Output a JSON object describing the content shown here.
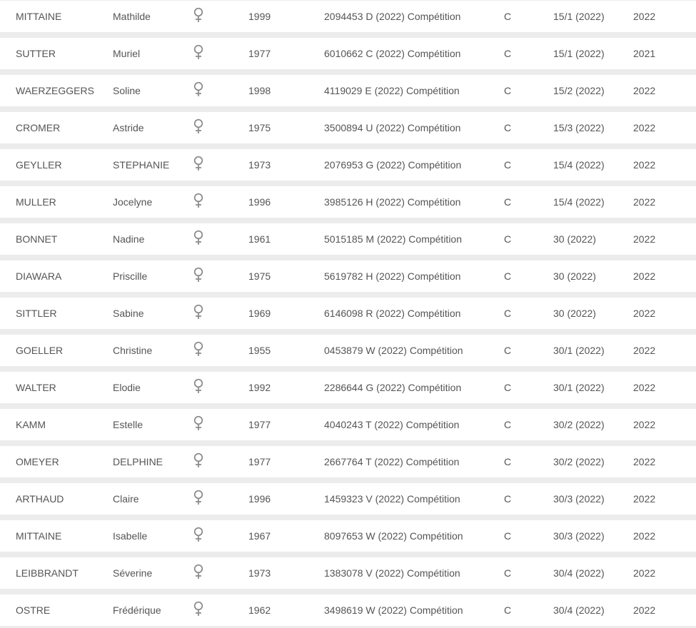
{
  "table": {
    "rows": [
      {
        "nom": "MITTAINE",
        "prenom": "Mathilde",
        "sexe_icon": "female-symbol-icon",
        "naissance": "1999",
        "licence": "2094453 D (2022) Compétition",
        "categorie": "C",
        "classement": "15/1 (2022)",
        "annee": "2022"
      },
      {
        "nom": "SUTTER",
        "prenom": "Muriel",
        "sexe_icon": "female-symbol-icon",
        "naissance": "1977",
        "licence": "6010662 C (2022) Compétition",
        "categorie": "C",
        "classement": "15/1 (2022)",
        "annee": "2021"
      },
      {
        "nom": "WAERZEGGERS",
        "prenom": "Soline",
        "sexe_icon": "female-symbol-icon",
        "naissance": "1998",
        "licence": "4119029 E (2022) Compétition",
        "categorie": "C",
        "classement": "15/2 (2022)",
        "annee": "2022"
      },
      {
        "nom": "CROMER",
        "prenom": "Astride",
        "sexe_icon": "female-symbol-icon",
        "naissance": "1975",
        "licence": "3500894 U (2022) Compétition",
        "categorie": "C",
        "classement": "15/3 (2022)",
        "annee": "2022"
      },
      {
        "nom": "GEYLLER",
        "prenom": "STEPHANIE",
        "sexe_icon": "female-symbol-icon",
        "naissance": "1973",
        "licence": "2076953 G (2022) Compétition",
        "categorie": "C",
        "classement": "15/4 (2022)",
        "annee": "2022"
      },
      {
        "nom": "MULLER",
        "prenom": "Jocelyne",
        "sexe_icon": "female-symbol-icon",
        "naissance": "1996",
        "licence": "3985126 H (2022) Compétition",
        "categorie": "C",
        "classement": "15/4 (2022)",
        "annee": "2022"
      },
      {
        "nom": "BONNET",
        "prenom": "Nadine",
        "sexe_icon": "female-symbol-icon",
        "naissance": "1961",
        "licence": "5015185 M (2022) Compétition",
        "categorie": "C",
        "classement": "30 (2022)",
        "annee": "2022"
      },
      {
        "nom": "DIAWARA",
        "prenom": "Priscille",
        "sexe_icon": "female-symbol-icon",
        "naissance": "1975",
        "licence": "5619782 H (2022) Compétition",
        "categorie": "C",
        "classement": "30 (2022)",
        "annee": "2022"
      },
      {
        "nom": "SITTLER",
        "prenom": "Sabine",
        "sexe_icon": "female-symbol-icon",
        "naissance": "1969",
        "licence": "6146098 R (2022) Compétition",
        "categorie": "C",
        "classement": "30 (2022)",
        "annee": "2022"
      },
      {
        "nom": "GOELLER",
        "prenom": "Christine",
        "sexe_icon": "female-symbol-icon",
        "naissance": "1955",
        "licence": "0453879 W (2022) Compétition",
        "categorie": "C",
        "classement": "30/1 (2022)",
        "annee": "2022"
      },
      {
        "nom": "WALTER",
        "prenom": "Elodie",
        "sexe_icon": "female-symbol-icon",
        "naissance": "1992",
        "licence": "2286644 G (2022) Compétition",
        "categorie": "C",
        "classement": "30/1 (2022)",
        "annee": "2022"
      },
      {
        "nom": "KAMM",
        "prenom": "Estelle",
        "sexe_icon": "female-symbol-icon",
        "naissance": "1977",
        "licence": "4040243 T (2022) Compétition",
        "categorie": "C",
        "classement": "30/2 (2022)",
        "annee": "2022"
      },
      {
        "nom": "OMEYER",
        "prenom": "DELPHINE",
        "sexe_icon": "female-symbol-icon",
        "naissance": "1977",
        "licence": "2667764 T (2022) Compétition",
        "categorie": "C",
        "classement": "30/2 (2022)",
        "annee": "2022"
      },
      {
        "nom": "ARTHAUD",
        "prenom": "Claire",
        "sexe_icon": "female-symbol-icon",
        "naissance": "1996",
        "licence": "1459323 V (2022) Compétition",
        "categorie": "C",
        "classement": "30/3 (2022)",
        "annee": "2022"
      },
      {
        "nom": "MITTAINE",
        "prenom": "Isabelle",
        "sexe_icon": "female-symbol-icon",
        "naissance": "1967",
        "licence": "8097653 W (2022) Compétition",
        "categorie": "C",
        "classement": "30/3 (2022)",
        "annee": "2022"
      },
      {
        "nom": "LEIBBRANDT",
        "prenom": "Séverine",
        "sexe_icon": "female-symbol-icon",
        "naissance": "1973",
        "licence": "1383078 V (2022) Compétition",
        "categorie": "C",
        "classement": "30/4 (2022)",
        "annee": "2022"
      },
      {
        "nom": "OSTRE",
        "prenom": "Frédérique",
        "sexe_icon": "female-symbol-icon",
        "naissance": "1962",
        "licence": "3498619 W (2022) Compétition",
        "categorie": "C",
        "classement": "30/4 (2022)",
        "annee": "2022"
      }
    ]
  },
  "colors": {
    "row_background": "#ffffff",
    "separator": "#ececec",
    "text": "#555555",
    "icon": "#888888"
  }
}
